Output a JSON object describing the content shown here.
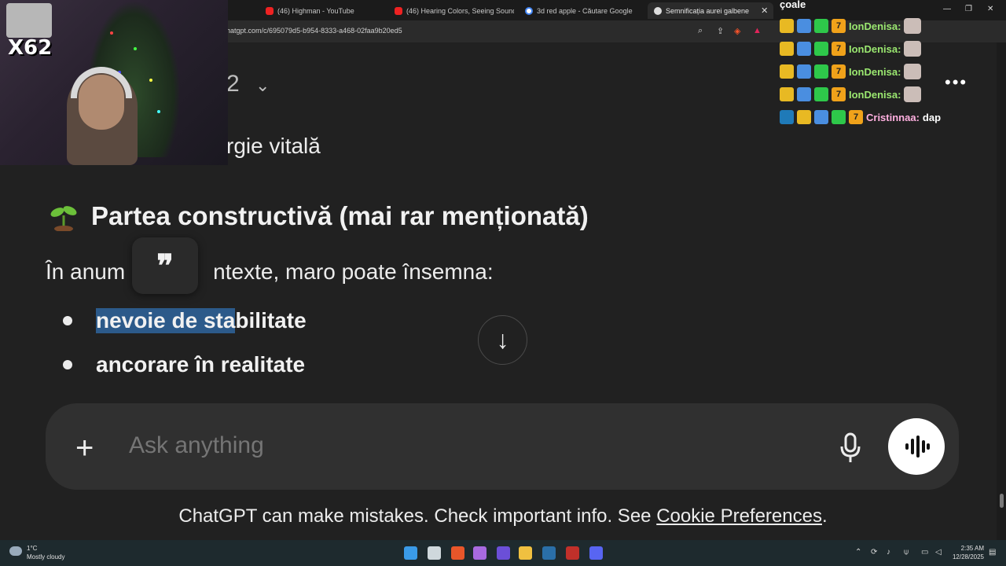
{
  "browser": {
    "tabs": [
      {
        "title": "(46) Highman - YouTube",
        "favicon": "youtube-icon"
      },
      {
        "title": "(46) Hearing Colors, Seeing Sounds:",
        "favicon": "youtube-icon"
      },
      {
        "title": "3d red apple - Căutare Google",
        "favicon": "google-icon"
      },
      {
        "title": "Semnificația aurei galbene",
        "favicon": "chatgpt-icon",
        "active": true
      }
    ],
    "url": "hatgpt.com/c/695079d5-b954-8333-a468-02faa9b20ed5"
  },
  "chat_page": {
    "model_label": "2",
    "previous_line": "rgie vitală",
    "heading": "Partea constructivă (mai rar menționată)",
    "heading_emoji": "seedling",
    "paragraph_start": "În anum",
    "paragraph_end": "ntexte, maro poate însemna:",
    "quote_glyph": "❞",
    "bullets": [
      {
        "selected": "nevoie de sta",
        "rest": "bilitate"
      },
      {
        "selected": "",
        "rest": "ancorare în realitate"
      }
    ],
    "scroll_down_glyph": "↓"
  },
  "composer": {
    "placeholder": "Ask anything",
    "plus_glyph": "+"
  },
  "disclaimer": {
    "text": "ChatGPT can make mistakes. Check important info. See ",
    "link": "Cookie Preferences",
    "end": "."
  },
  "overlay": {
    "viewer_tag": "X62",
    "chat_top": "çoale",
    "chat_messages": [
      {
        "user": "IonDenisa:",
        "color": "#9be870"
      },
      {
        "user": "IonDenisa:",
        "color": "#9be870"
      },
      {
        "user": "IonDenisa:",
        "color": "#9be870"
      },
      {
        "user": "IonDenisa:",
        "color": "#9be870"
      },
      {
        "user": "Cristinnaa:",
        "message": "dap",
        "color": "#ffb0e0"
      }
    ]
  },
  "taskbar": {
    "weather_temp": "1°C",
    "weather_desc": "Mostly cloudy",
    "time": "2:35 AM",
    "date": "12/28/2025"
  }
}
